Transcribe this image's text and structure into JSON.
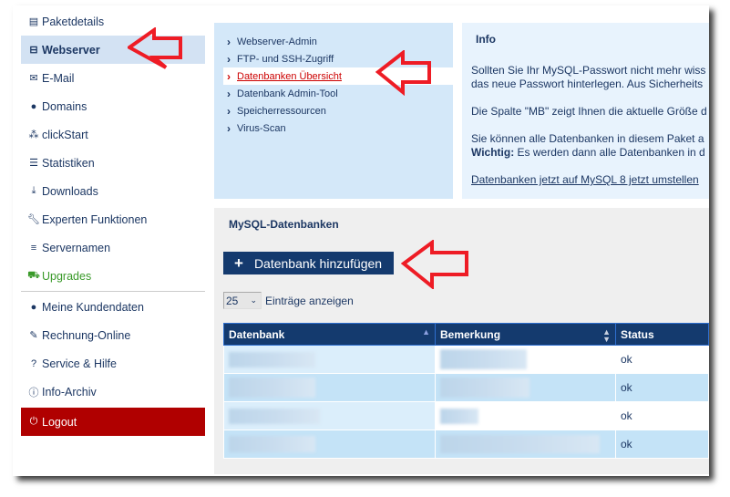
{
  "sidebar": {
    "items": [
      {
        "label": "Paketdetails",
        "icon": "list-icon"
      },
      {
        "label": "Webserver",
        "icon": "hdd-icon",
        "active": true
      },
      {
        "label": "E-Mail",
        "icon": "envelope-icon"
      },
      {
        "label": "Domains",
        "icon": "globe-icon"
      },
      {
        "label": "clickStart",
        "icon": "cubes-icon"
      },
      {
        "label": "Statistiken",
        "icon": "stats-icon"
      },
      {
        "label": "Downloads",
        "icon": "download-icon"
      },
      {
        "label": "Experten Funktionen",
        "icon": "wrench-icon"
      },
      {
        "label": "Servernamen",
        "icon": "bars-icon"
      },
      {
        "label": "Upgrades",
        "icon": "cart-icon"
      },
      {
        "label": "Meine Kundendaten",
        "icon": "user-icon"
      },
      {
        "label": "Rechnung-Online",
        "icon": "pencil-icon"
      },
      {
        "label": "Service & Hilfe",
        "icon": "question-icon"
      },
      {
        "label": "Info-Archiv",
        "icon": "info-icon"
      },
      {
        "label": "Logout",
        "icon": "power-icon"
      }
    ]
  },
  "subnav": {
    "items": [
      "Webserver-Admin",
      "FTP- und SSH-Zugriff",
      "Datenbanken Übersicht",
      "Datenbank Admin-Tool",
      "Speicherressourcen",
      "Virus-Scan"
    ],
    "active_index": 2
  },
  "info": {
    "title": "Info",
    "p1a": "Sollten Sie Ihr MySQL-Passwort nicht mehr wiss",
    "p1b": "das neue Passwort hinterlegen. Aus Sicherheits",
    "p2": "Die Spalte \"MB\" zeigt Ihnen die aktuelle Größe d",
    "p3a": "Sie können alle Datenbanken in diesem Paket a",
    "p3b_bold": "Wichtig:",
    "p3b": " Es werden dann alle Datenbanken in d",
    "link": "Datenbanken jetzt auf MySQL 8 jetzt umstellen"
  },
  "main": {
    "section_title": "MySQL-Datenbanken",
    "add_button": "Datenbank hinzufügen",
    "page_length": "25",
    "page_length_label": "Einträge anzeigen",
    "table": {
      "headers": [
        "Datenbank",
        "Bemerkung",
        "Status"
      ],
      "rows": [
        {
          "status": "ok"
        },
        {
          "status": "ok"
        },
        {
          "status": "ok"
        },
        {
          "status": "ok"
        }
      ]
    }
  },
  "colors": {
    "navy": "#143a6e",
    "accent_red": "#cc0000",
    "annotation_arrow": "#ee1c25",
    "logout_bg": "#b00000",
    "upgrades_green": "#3a9a2a"
  }
}
